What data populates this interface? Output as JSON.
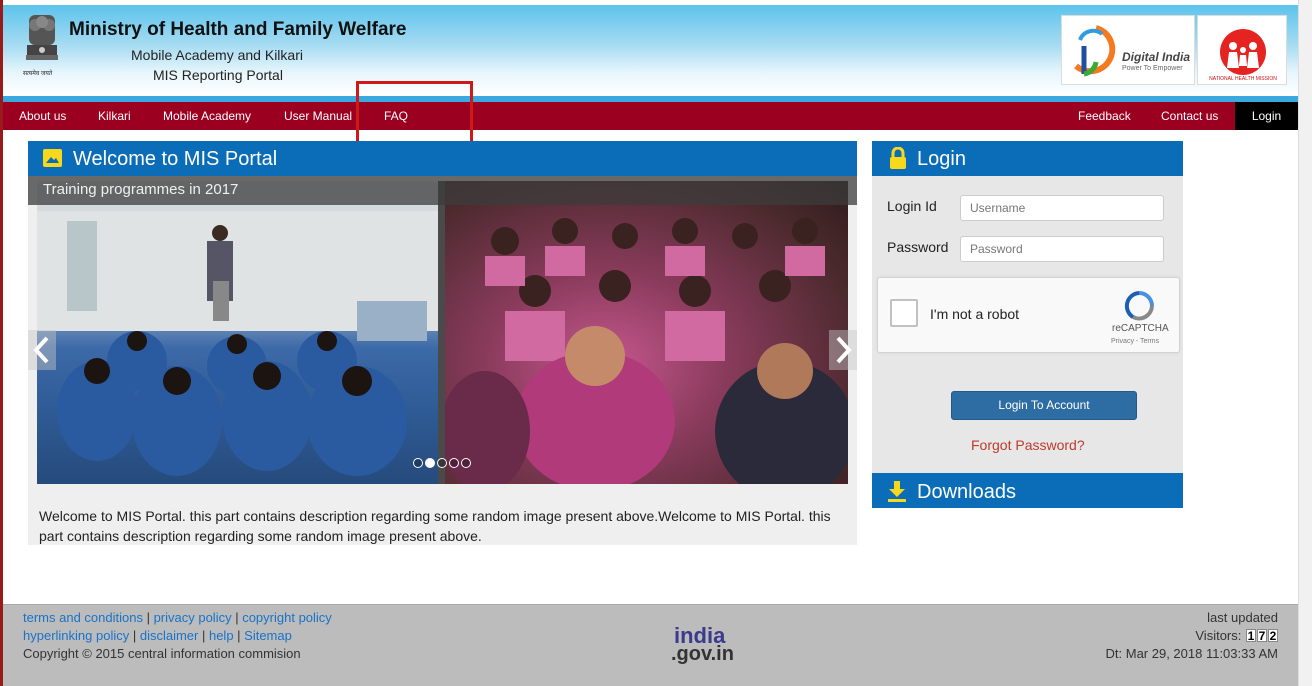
{
  "header": {
    "title": "Ministry of Health and Family Welfare",
    "subtitle1": "Mobile Academy and Kilkari",
    "subtitle2": "MIS Reporting Portal",
    "emblem_caption": "सत्यमेव जयते",
    "digital_india": "Digital India",
    "digital_india_tagline": "Power To Empower",
    "nhm": "NATIONAL HEALTH MISSION"
  },
  "nav": {
    "left": [
      "About us",
      "Kilkari",
      "Mobile Academy",
      "User Manual",
      "FAQ"
    ],
    "right": [
      "Feedback",
      "Contact us"
    ],
    "login": "Login"
  },
  "welcome": {
    "title": "Welcome to MIS Portal",
    "caption": "Training programmes in 2017",
    "slide_count": 5,
    "active_slide": 1,
    "description": "Welcome to MIS Portal. this part contains description regarding some random image present above.Welcome to MIS Portal. this part contains description regarding some random image present above."
  },
  "login": {
    "title": "Login",
    "login_id_label": "Login Id",
    "login_id_placeholder": "Username",
    "password_label": "Password",
    "password_placeholder": "Password",
    "captcha_text": "I'm not a robot",
    "captcha_brand": "reCAPTCHA",
    "captcha_links": "Privacy - Terms",
    "button": "Login To Account",
    "forgot": "Forgot Password?"
  },
  "downloads": {
    "title": "Downloads"
  },
  "footer": {
    "links_row1": [
      "terms and conditions",
      "privacy policy",
      "copyright policy"
    ],
    "links_row2": [
      "hyperlinking policy",
      "disclaimer",
      "help",
      "Sitemap"
    ],
    "copyright": "Copyright © 2015 central information commision",
    "india_top": "india",
    "india_bottom": ".gov.in",
    "last_updated_label": "last updated",
    "visitors_label": "Visitors:",
    "visitors_digits": [
      "1",
      "7",
      "2"
    ],
    "date": "Dt: Mar 29, 2018 11:03:33 AM"
  },
  "colors": {
    "nav": "#9b0020",
    "panel_header": "#0b6db8",
    "highlight": "#d01818",
    "link": "#1a73c8"
  }
}
